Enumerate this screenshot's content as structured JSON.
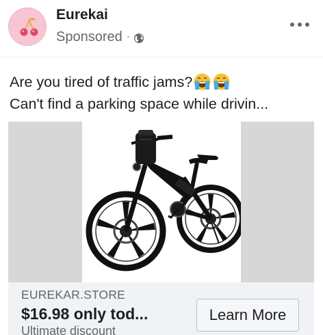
{
  "post": {
    "page_name": "Eurekai",
    "sponsored_label": "Sponsored",
    "separator": "·",
    "privacy_icon": "globe-icon",
    "more_icon": "more-options-icon",
    "avatar_icon": "cherries-icon"
  },
  "caption": {
    "line1": "Are you tired of traffic jams?",
    "line1_emojis": [
      "crying-face-emoji",
      "crying-face-emoji"
    ],
    "line2": "Can't find a parking space while drivin..."
  },
  "media": {
    "image": "folding-electric-bicycle-image"
  },
  "link": {
    "domain": "EUREKAR.STORE",
    "headline": "$16.98  only tod...",
    "description": "Ultimate discount",
    "cta_label": "Learn More"
  },
  "colors": {
    "text_primary": "#1c1e21",
    "text_secondary": "#65676b",
    "link_bar_bg": "#f0f2f5",
    "media_side_bg": "#d7d7d7",
    "avatar_bg": "#f6c6d3"
  }
}
